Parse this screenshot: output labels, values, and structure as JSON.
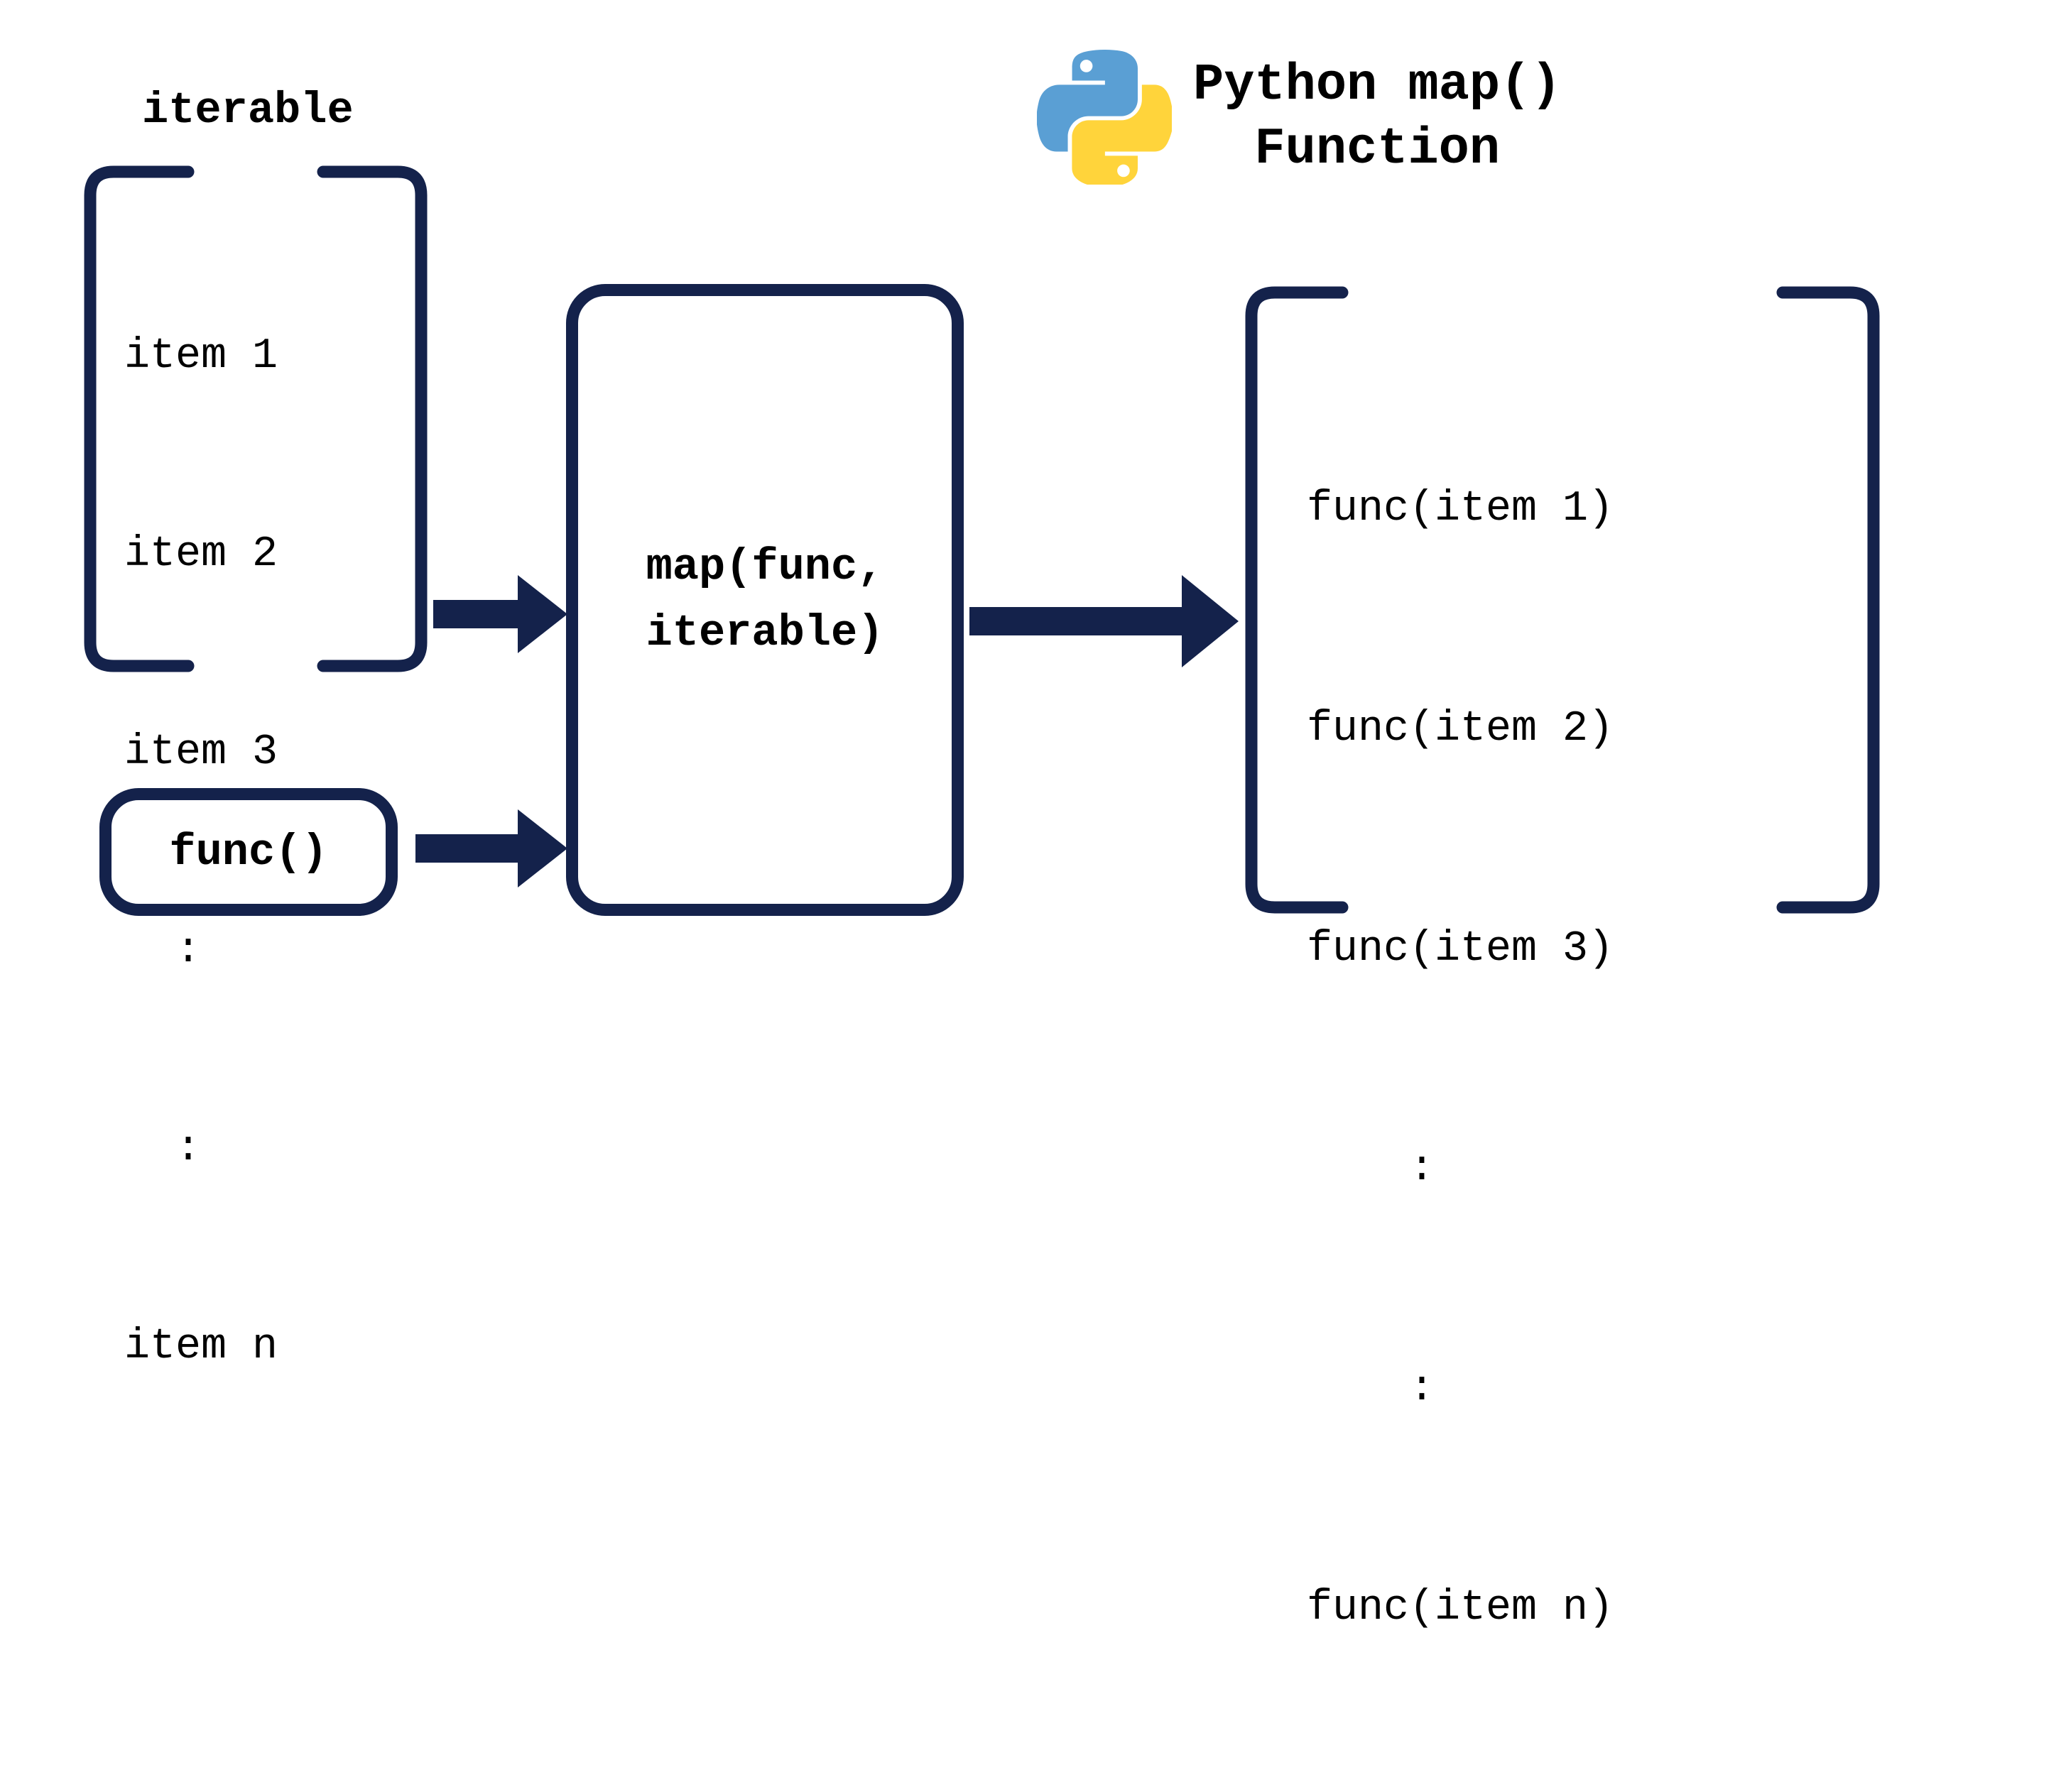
{
  "title": {
    "line1": "Python map()",
    "line2": "Function"
  },
  "iterable": {
    "label": "iterable",
    "items": [
      "item 1",
      "item 2",
      "item 3",
      "  :",
      "  :",
      "item n"
    ]
  },
  "func": {
    "label": "func()"
  },
  "map_box": {
    "line1": "map(func,",
    "line2": "iterable)"
  },
  "output": {
    "items": [
      "func(item 1)",
      "func(item 2)",
      "func(item 3)",
      "    :",
      "    :",
      "func(item n)"
    ]
  },
  "colors": {
    "navy": "#14224b",
    "py_blue": "#4B8BBE",
    "py_yellow": "#FFE873"
  }
}
